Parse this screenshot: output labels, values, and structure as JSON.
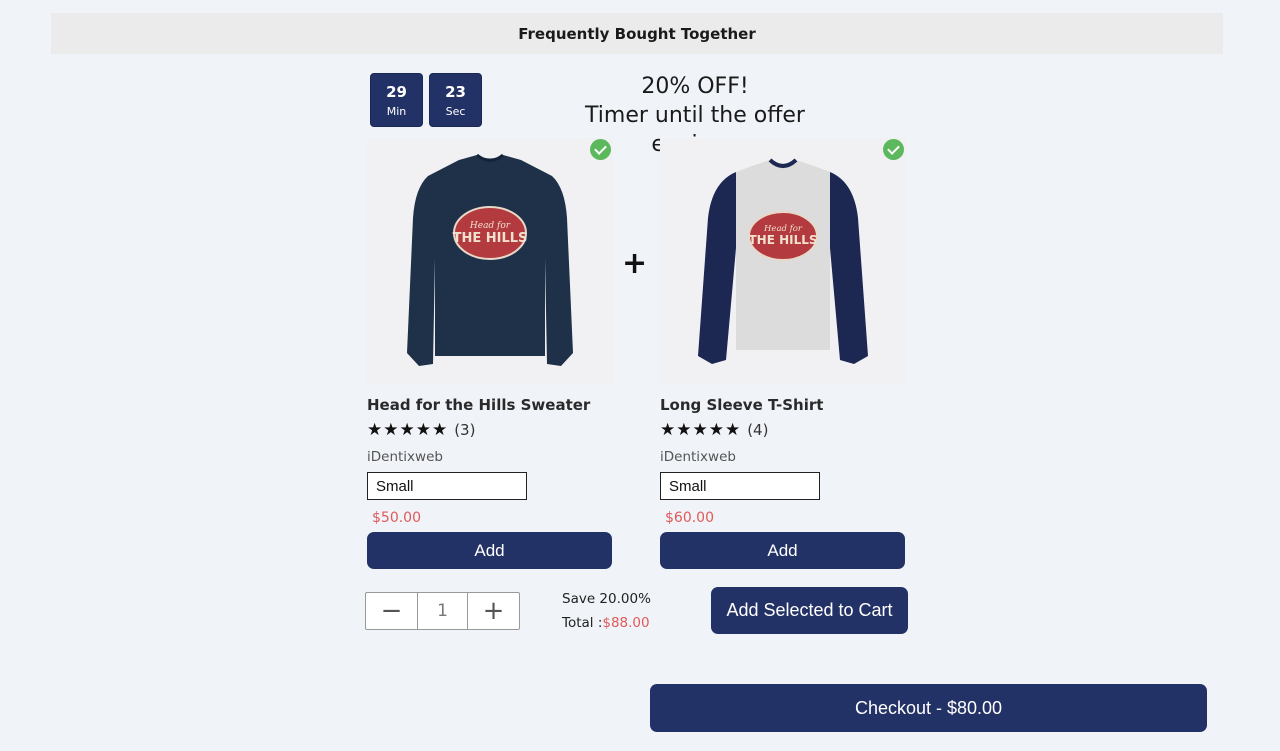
{
  "header": {
    "title": "Frequently Bought Together"
  },
  "timer": {
    "minutes": "29",
    "minutes_label": "Min",
    "seconds": "23",
    "seconds_label": "Sec"
  },
  "offer": {
    "headline": "20% OFF!",
    "subline": "Timer until the offer expires:"
  },
  "separator": "+",
  "products": [
    {
      "name": "Head for the Hills Sweater",
      "stars": "★★★★★",
      "review_count": "(3)",
      "vendor": "iDentixweb",
      "variant": "Small",
      "price": "$50.00",
      "add_label": "Add",
      "image_icon": "sweater-image"
    },
    {
      "name": "Long Sleeve T-Shirt",
      "stars": "★★★★★",
      "review_count": "(4)",
      "vendor": "iDentixweb",
      "variant": "Small",
      "price": "$60.00",
      "add_label": "Add",
      "image_icon": "tshirt-image"
    }
  ],
  "quantity": {
    "minus": "−",
    "value": "1",
    "plus": "+"
  },
  "summary": {
    "save_text": "Save 20.00%",
    "total_label": "Total :",
    "total_value": "$88.00"
  },
  "actions": {
    "add_selected_label": "Add Selected to Cart",
    "checkout_label": "Checkout - $80.00"
  },
  "colors": {
    "primary": "#233266",
    "price": "#e05a5a",
    "check": "#5cb85c",
    "sweater": "#1f3049",
    "badge": "#b33a3f"
  }
}
